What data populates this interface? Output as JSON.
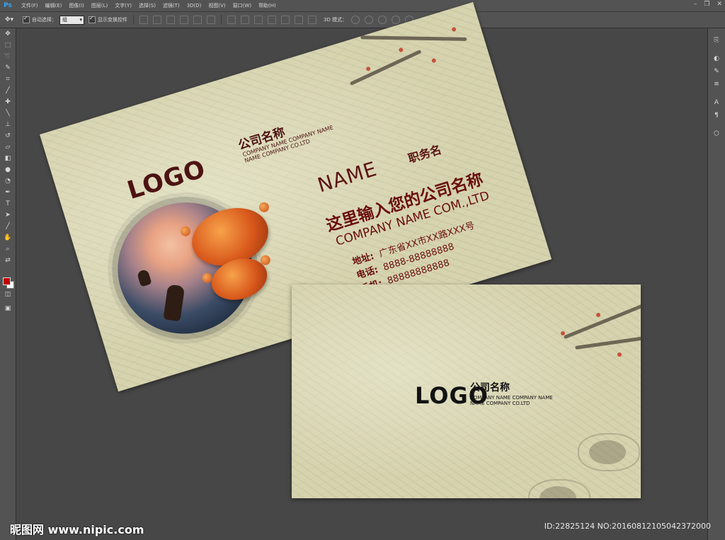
{
  "app": {
    "name": "Ps",
    "menu": [
      "文件(F)",
      "编辑(E)",
      "图像(I)",
      "图层(L)",
      "文字(Y)",
      "选择(S)",
      "滤镜(T)",
      "3D(D)",
      "视图(V)",
      "窗口(W)",
      "帮助(H)"
    ]
  },
  "options_bar": {
    "auto_select_label": "自动选择：",
    "auto_select_value": "组",
    "show_transform_label": "显示变换控件",
    "mode_3d_label": "3D 模式："
  },
  "colors": {
    "foreground": "#c00000",
    "background": "#ffffff",
    "card_text": "#4d1313",
    "card_paper": "#d6d3af"
  },
  "card_front": {
    "logo": "LOGO",
    "company_cn": "公司名称",
    "company_en_line1": "COMPANY NAME COMPANY NAME",
    "company_en_line2": "NAME COMPANY CO.LTD",
    "name": "NAME",
    "title": "职务名",
    "slogan": "这里输入您的公司名称",
    "company_en_full": "COMPANY NAME COM.,LTD",
    "address_label": "地址:",
    "address_value": "广东省XX市XX路XXX号",
    "phone_label": "电话:",
    "phone_value": "8888-88888888",
    "mobile_label": "手机:",
    "mobile_value": "88888888888"
  },
  "card_back": {
    "logo": "LOGO",
    "company_cn": "公司名称",
    "company_en_line1": "COMPANY NAME COMPANY NAME",
    "company_en_line2": "NAME COMPANY CO.LTD"
  },
  "watermark": {
    "site": "昵图网 www.nipic.com",
    "id": "ID:22825124 NO:20160812105042372000"
  }
}
